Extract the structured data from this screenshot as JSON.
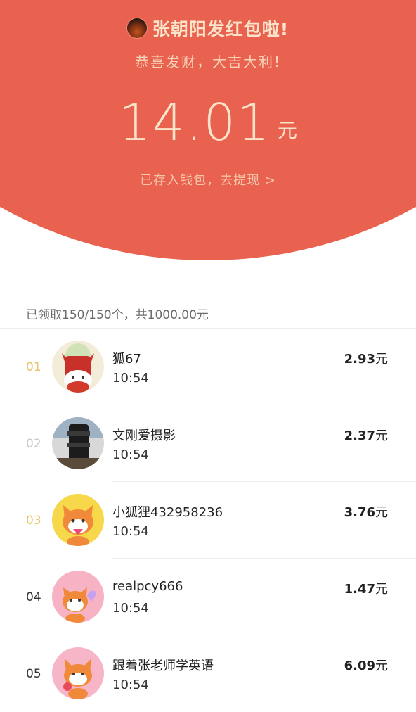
{
  "header": {
    "sender_text": "张朝阳发红包啦!",
    "blessing": "恭喜发财，大吉大利!",
    "amount": "14.01",
    "amount_unit": "元",
    "wallet_link": "已存入钱包，去提现 >"
  },
  "summary": "已领取150/150个，共1000.00元",
  "colors": {
    "header_bg": "#E8624F",
    "gold_text": "#FBE3C9",
    "rank_gold": "#E7C36A",
    "rank_gray": "#C9C9C9",
    "rank_dark": "#333333"
  },
  "records": [
    {
      "rank": "01",
      "name": "狐67",
      "time": "10:54",
      "amount": "2.93",
      "unit": "元",
      "avatar": "red-fox-avatar"
    },
    {
      "rank": "02",
      "name": "文刚爱摄影",
      "time": "10:54",
      "amount": "2.37",
      "unit": "元",
      "avatar": "camera-lens-avatar"
    },
    {
      "rank": "03",
      "name": "小狐狸432958236",
      "time": "10:54",
      "amount": "3.76",
      "unit": "元",
      "avatar": "fox-yellow-avatar"
    },
    {
      "rank": "04",
      "name": "realpcy666",
      "time": "10:54",
      "amount": "1.47",
      "unit": "元",
      "avatar": "fox-pink-avatar"
    },
    {
      "rank": "05",
      "name": "跟着张老师学英语",
      "time": "10:54",
      "amount": "6.09",
      "unit": "元",
      "avatar": "fox-pink2-avatar"
    }
  ]
}
